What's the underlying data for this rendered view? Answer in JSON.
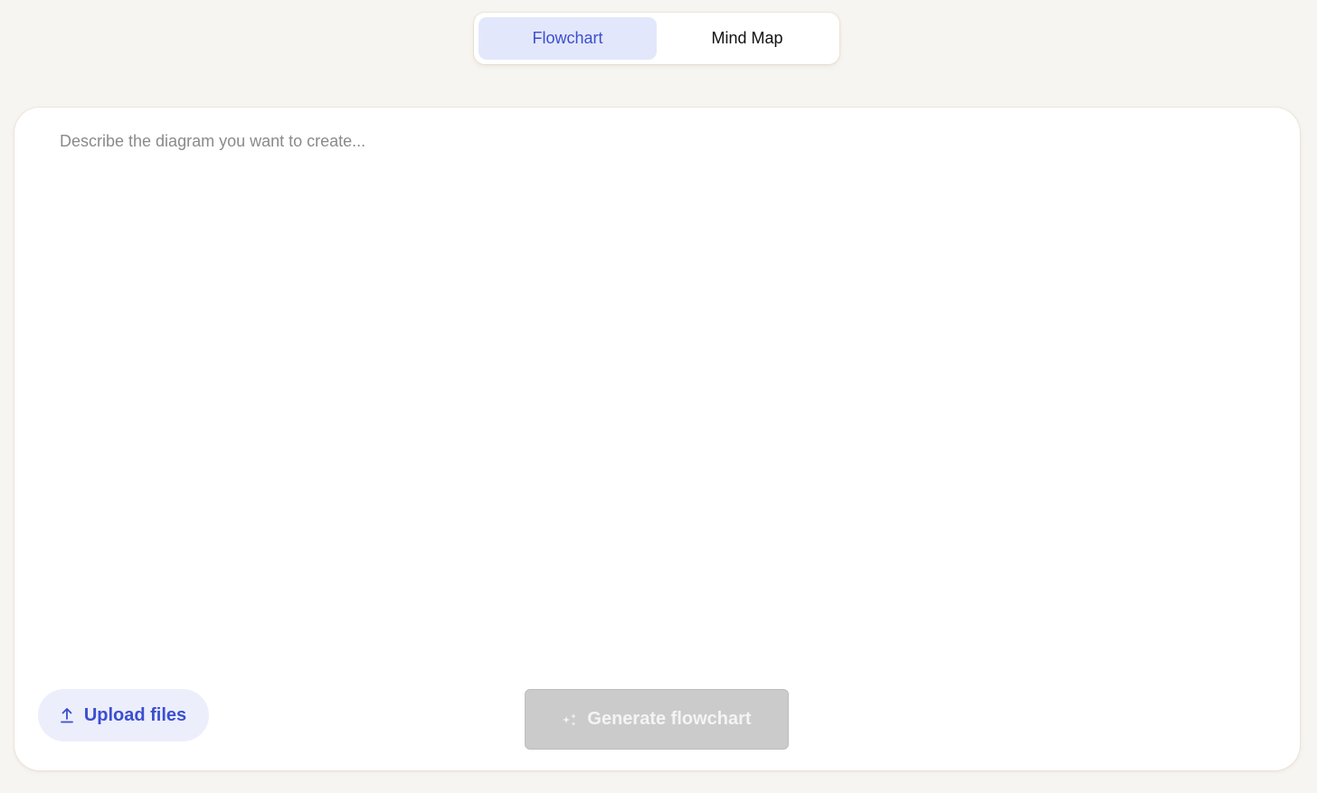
{
  "mode_toggle": {
    "tabs": [
      {
        "label": "Flowchart",
        "active": true
      },
      {
        "label": "Mind Map",
        "active": false
      }
    ]
  },
  "prompt": {
    "placeholder": "Describe the diagram you want to create...",
    "value": ""
  },
  "actions": {
    "upload_label": "Upload files",
    "upload_icon": "upload-arrow-icon",
    "generate_label": "Generate flowchart",
    "generate_icon": "sparkle-icon",
    "generate_disabled": true
  },
  "colors": {
    "accent": "#3b4fcf",
    "accent_bg": "#e3e7fb",
    "page_bg": "#f7f5f1",
    "disabled_bg": "#cbcbcb"
  }
}
